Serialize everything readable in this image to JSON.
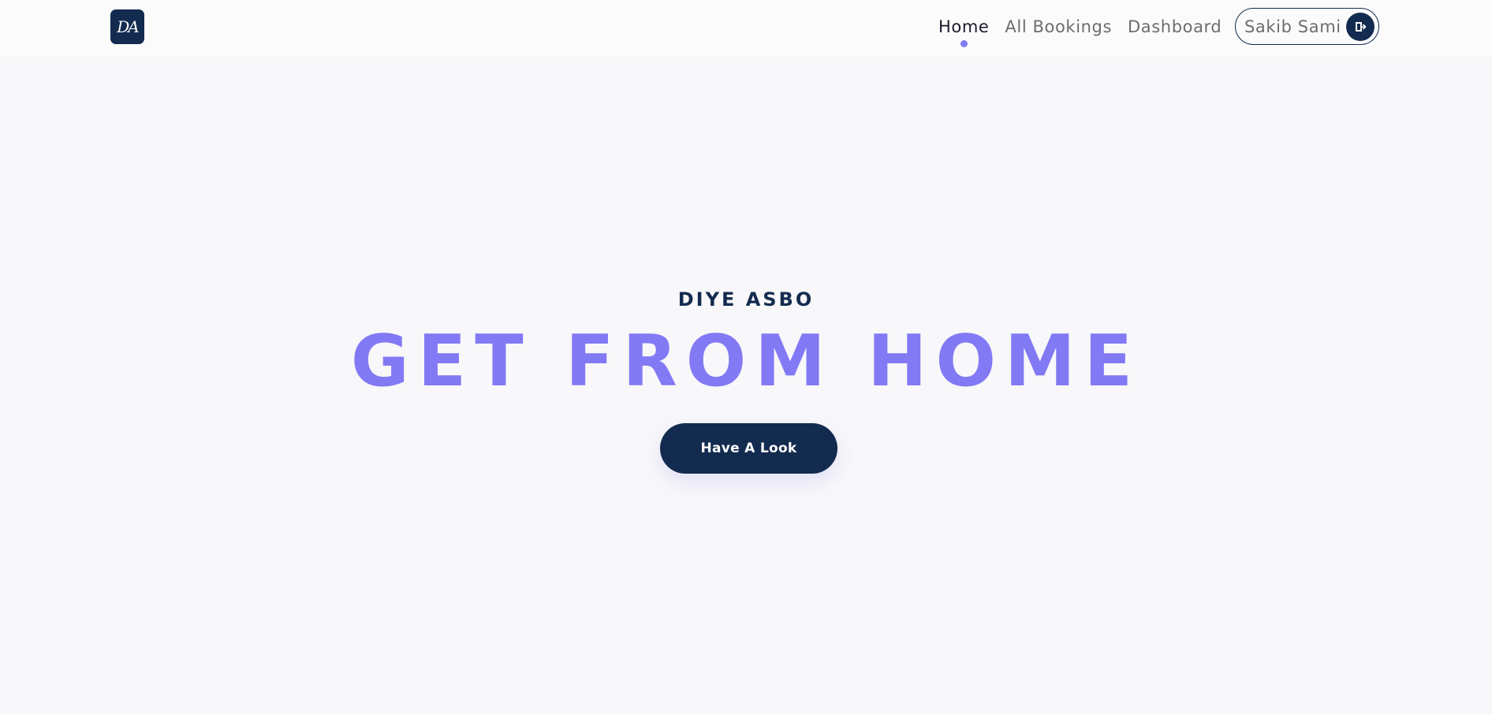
{
  "header": {
    "logo_text": "DA",
    "nav": [
      {
        "label": "Home",
        "active": true
      },
      {
        "label": "All Bookings",
        "active": false
      },
      {
        "label": "Dashboard",
        "active": false
      }
    ],
    "user": {
      "name": "Sakib Sami",
      "logout_icon": "logout-door-icon"
    }
  },
  "hero": {
    "subtitle": "DIYE ASBO",
    "title": "GET FROM HOME",
    "button_label": "Have A Look"
  },
  "colors": {
    "primary_navy": "#132b4e",
    "accent_purple": "#8279f5",
    "background": "#f8f7f9"
  }
}
